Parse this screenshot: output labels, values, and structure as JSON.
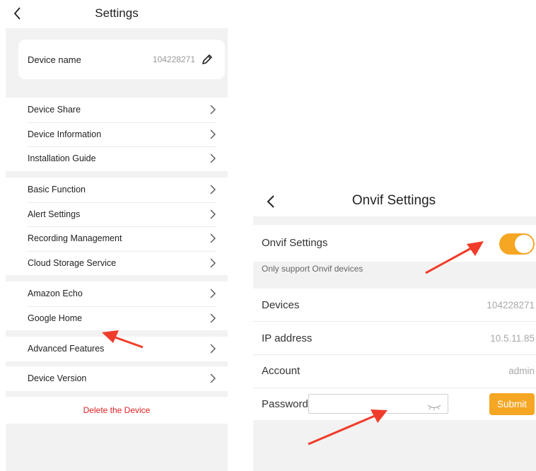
{
  "left": {
    "title": "Settings",
    "device_name_label": "Device name",
    "device_name_value": "104228271",
    "groups": [
      [
        "Device Share",
        "Device Information",
        "Installation Guide"
      ],
      [
        "Basic Function",
        "Alert Settings",
        "Recording Management",
        "Cloud Storage Service"
      ],
      [
        "Amazon Echo",
        "Google Home"
      ],
      [
        "Advanced Features"
      ],
      [
        "Device Version"
      ]
    ],
    "delete_label": "Delete the Device"
  },
  "right": {
    "title": "Onvif Settings",
    "toggle_label": "Onvif Settings",
    "toggle_on": true,
    "note": "Only support Onvif devices",
    "devices_label": "Devices",
    "devices_value": "104228271",
    "ip_label": "IP address",
    "ip_value": "10.5.11.85",
    "account_label": "Account",
    "account_value": "admin",
    "password_label": "Password",
    "password_value": "",
    "submit_label": "Submit"
  },
  "colors": {
    "accent": "#f5a623",
    "delete": "#e02020",
    "annotation_arrow": "#f03c2a"
  },
  "icons": [
    "back-icon",
    "pencil-icon",
    "chevron-right-icon",
    "eye-closed-icon",
    "annotation-arrow-icon"
  ]
}
